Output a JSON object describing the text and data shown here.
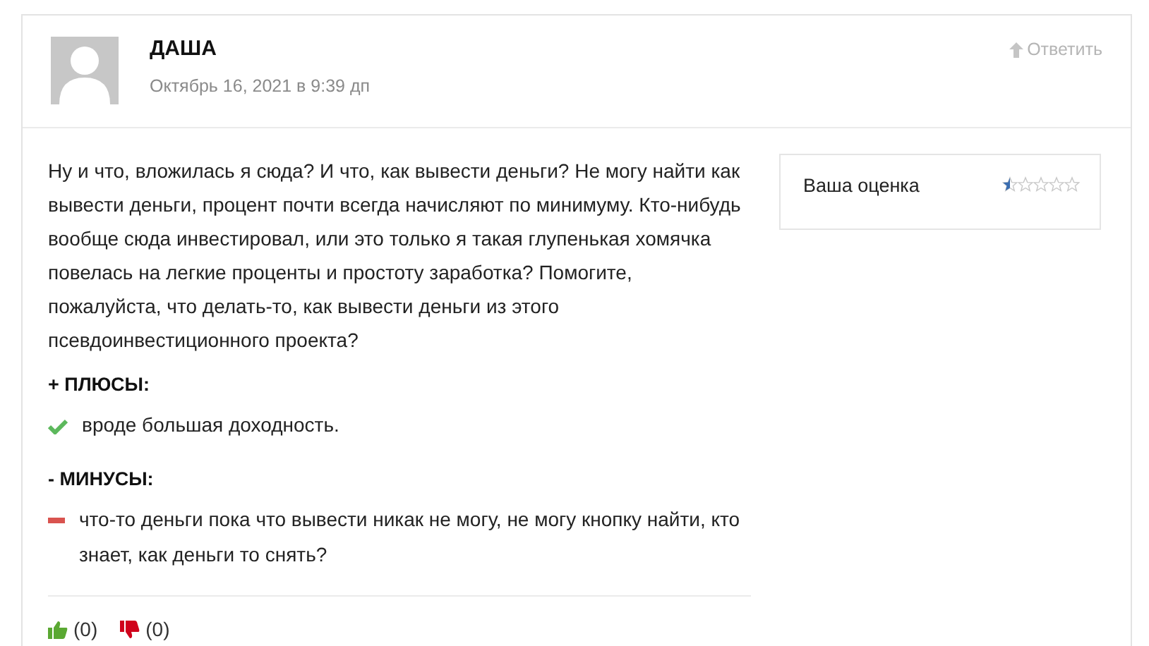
{
  "review": {
    "author": "ДАША",
    "date": "Октябрь 16, 2021 в 9:39 дп",
    "reply": "Ответить",
    "text": "Ну и что, вложилась я сюда? И что, как вывести деньги? Не могу найти как вывести деньги, процент почти всегда начисляют по минимуму. Кто-нибудь вообще сюда инвестировал, или это только я такая глупенькая хомячка повелась на легкие проценты и простоту заработка? Помогите, пожалуйста, что делать-то, как вывести деньги из этого псевдоинвестиционного проекта?",
    "sections": [
      {
        "kind": "pros",
        "title": "+ ПЛЮСЫ:",
        "items": [
          "вроде большая доходность."
        ]
      },
      {
        "kind": "cons",
        "title": "- МИНУСЫ:",
        "items": [
          "что-то деньги пока что вывести никак не могу, не могу кнопку найти, кто знает, как деньги то снять?"
        ]
      }
    ],
    "votes": [
      {
        "kind": "up",
        "count": "(0)"
      },
      {
        "kind": "down",
        "count": "(0)"
      }
    ]
  },
  "rating": {
    "label": "Ваша оценка",
    "stars": 0.5
  }
}
